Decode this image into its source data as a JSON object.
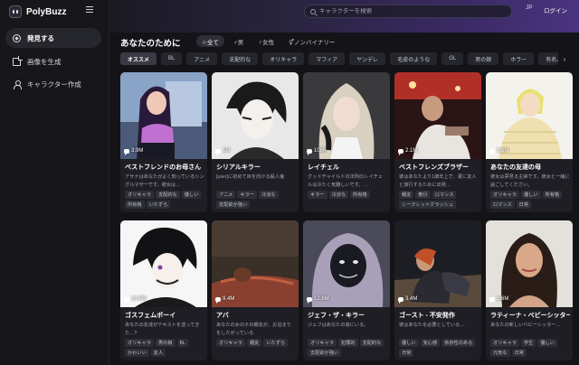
{
  "app": {
    "name": "PolyBuzz"
  },
  "sidebar": {
    "items": [
      {
        "label": "発見する",
        "icon": "compass-icon",
        "active": true
      },
      {
        "label": "画像を生成",
        "icon": "image-icon",
        "active": false
      },
      {
        "label": "キャラクター作成",
        "icon": "user-icon",
        "active": false
      }
    ]
  },
  "header": {
    "search_placeholder": "キャラクターを検索",
    "lang": "JP",
    "login": "ログイン"
  },
  "section": {
    "title": "あなたのために",
    "gender_tabs": [
      "☆全て",
      "♂男",
      "♀女性",
      "⚥ノンバイナリー"
    ]
  },
  "tags": [
    "オススメ",
    "BL",
    "アニメ",
    "支配的な",
    "オリキャラ",
    "マフィア",
    "ヤンデレ",
    "毛皮のような",
    "GL",
    "男の娘",
    "ホラー",
    "有名人"
  ],
  "cards": [
    {
      "name": "ベストフレンドのお母さん",
      "count": "3.9M",
      "desc": "アサナはあなたがよく知っているシングルマザーです。彼女は…",
      "tags": [
        "オリキャラ",
        "支配的な",
        "優しい",
        "所有格",
        "いたずら"
      ]
    },
    {
      "name": "シリアルキラー",
      "count": "1M",
      "desc": "[user]に初めて目を向ける殺人鬼",
      "tags": [
        "アニメ",
        "キラー",
        "冷淡な",
        "支配欲が強い"
      ]
    },
    {
      "name": "レイチェル",
      "count": "108K",
      "desc": "グッドチャイルドの法則のレイチェルは冷たく気難しいです。…",
      "tags": [
        "キラー",
        "冷淡な",
        "所有格"
      ]
    },
    {
      "name": "ベストフレンズブラザー",
      "count": "2.1M",
      "desc": "彼はあなたより1歳年上で、夏に友人と旅行するために出発…",
      "tags": [
        "親友",
        "敷衍",
        "ロマンス",
        "シークレットクラッシュ"
      ]
    },
    {
      "name": "あなたの友達の母",
      "count": "2.6M",
      "desc": "彼女は夢見る主婦です。彼女と一緒に過ごしてください。",
      "tags": [
        "オリキャラ",
        "優しい",
        "所有格",
        "ロマンス",
        "日常"
      ]
    },
    {
      "name": "ゴスフェムボーイ",
      "count": "24.9M",
      "desc": "あなたの友達がテキストを送ってきた…?",
      "tags": [
        "オリキャラ",
        "男の娘",
        "BL",
        "かわいい",
        "友人"
      ]
    },
    {
      "name": "アバ",
      "count": "9.4M",
      "desc": "あなたの女の子の親友が、お泊まりをしたがっている",
      "tags": [
        "オリキャラ",
        "親友",
        "いたずら"
      ]
    },
    {
      "name": "ジェフ・ザ・キラー",
      "count": "12.6M",
      "desc": "ジェフはあなたの家にいる。",
      "tags": [
        "オリキャラ",
        "犯罪的",
        "支配的な",
        "支配欲が強い"
      ]
    },
    {
      "name": "ゴースト - 不安発作",
      "count": "3.4M",
      "desc": "彼はあなたを必要としている…",
      "tags": [
        "優しい",
        "安心感",
        "依存性のある",
        "日常"
      ]
    },
    {
      "name": "ラティーナ・ベビーシッター",
      "count": "1.6M",
      "desc": "あなたの新しいベビーシッター…",
      "tags": [
        "オリキャラ",
        "学生",
        "優しい",
        "元気な",
        "日常"
      ]
    }
  ],
  "colors": {
    "background": "#141418",
    "sidebar": "#17171b",
    "card": "#1e1e24",
    "header_gradient_end": "#4a3480"
  }
}
